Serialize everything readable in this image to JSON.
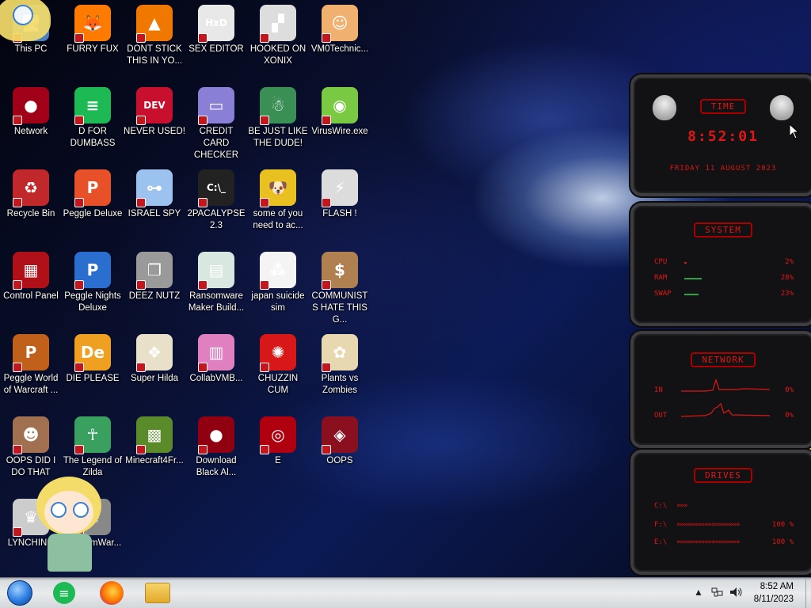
{
  "desktop": {
    "icons": [
      {
        "label": "This PC",
        "glyph": "🖥",
        "color": "#4a7fc1"
      },
      {
        "label": "FURRY FUX",
        "glyph": "🦊",
        "color": "#ff7a00"
      },
      {
        "label": "DONT STICK THIS IN YO...",
        "glyph": "▲",
        "color": "#f07800"
      },
      {
        "label": "SEX EDITOR",
        "glyph": "HxD",
        "color": "#e8e8e8"
      },
      {
        "label": "HOOKED ON XONIX",
        "glyph": "▞",
        "color": "#dddddd"
      },
      {
        "label": "VM0Technic...",
        "glyph": "☺",
        "color": "#f0b070"
      },
      {
        "label": "Network",
        "glyph": "●",
        "color": "#a00018"
      },
      {
        "label": "D FOR DUMBASS",
        "glyph": "≡",
        "color": "#1db954"
      },
      {
        "label": "NEVER USED!",
        "glyph": "DEV",
        "color": "#c8102e"
      },
      {
        "label": "CREDIT CARD CHECKER",
        "glyph": "▭",
        "color": "#8a7fd6"
      },
      {
        "label": "BE JUST LIKE THE DUDE!",
        "glyph": "☃",
        "color": "#3a8f54"
      },
      {
        "label": "VirusWire.exe",
        "glyph": "◉",
        "color": "#7ac943"
      },
      {
        "label": "Recycle Bin",
        "glyph": "♻",
        "color": "#c0282c"
      },
      {
        "label": "Peggle Deluxe",
        "glyph": "P",
        "color": "#e8502a"
      },
      {
        "label": "ISRAEL SPY",
        "glyph": "⊶",
        "color": "#9cc3f0"
      },
      {
        "label": "2PACALYPSE 2.3",
        "glyph": "C:\\_",
        "color": "#222222"
      },
      {
        "label": "some of you need to ac...",
        "glyph": "🐶",
        "color": "#e8c020"
      },
      {
        "label": "FLASH !",
        "glyph": "⚡",
        "color": "#dcdcdc"
      },
      {
        "label": "Control Panel",
        "glyph": "▦",
        "color": "#b01018"
      },
      {
        "label": "Peggle Nights Deluxe",
        "glyph": "P",
        "color": "#2a6fd0"
      },
      {
        "label": "DEEZ NUTZ",
        "glyph": "❐",
        "color": "#9a9a9a"
      },
      {
        "label": "Ransomware Maker Build...",
        "glyph": "▤",
        "color": "#d8e8e0"
      },
      {
        "label": "japan suicide sim",
        "glyph": "⁂",
        "color": "#f4f4f4"
      },
      {
        "label": "COMMUNISTS HATE THIS G...",
        "glyph": "$",
        "color": "#b08050"
      },
      {
        "label": "Peggle World of Warcraft ...",
        "glyph": "P",
        "color": "#c0601a"
      },
      {
        "label": "DIE PLEASE",
        "glyph": "De",
        "color": "#f0a020"
      },
      {
        "label": "Super Hilda",
        "glyph": "❖",
        "color": "#e8e0c8"
      },
      {
        "label": "CollabVMB...",
        "glyph": "▥",
        "color": "#e080c0"
      },
      {
        "label": "CHUZZIN CUM",
        "glyph": "✺",
        "color": "#d81818"
      },
      {
        "label": "Plants vs Zombies",
        "glyph": "✿",
        "color": "#e8d8b0"
      },
      {
        "label": "OOPS DID I DO THAT",
        "glyph": "☻",
        "color": "#a07050"
      },
      {
        "label": "The Legend of Zilda",
        "glyph": "☥",
        "color": "#3aa060"
      },
      {
        "label": "Minecraft4Fr...",
        "glyph": "▩",
        "color": "#5a8a2a"
      },
      {
        "label": "Download Black Al...",
        "glyph": "●",
        "color": "#900010"
      },
      {
        "label": "E",
        "glyph": "◎",
        "color": "#b00010"
      },
      {
        "label": "OOPS",
        "glyph": "◈",
        "color": "#8a1020"
      },
      {
        "label": "LYNCHING",
        "glyph": "♛",
        "color": "#cccccc"
      },
      {
        "label": "RansomWar...",
        "glyph": "☠",
        "color": "#888888"
      }
    ]
  },
  "widgets": {
    "time": {
      "title": "TIME",
      "time": "8:52:01",
      "date": "FRIDAY 11 AUGUST 2023"
    },
    "system": {
      "title": "SYSTEM",
      "rows": [
        {
          "label": "CPU",
          "value": "2%",
          "level": 0.02
        },
        {
          "label": "RAM",
          "value": "28%",
          "level": 0.28
        },
        {
          "label": "SWAP",
          "value": "23%",
          "level": 0.23
        }
      ]
    },
    "network": {
      "title": "NETWORK",
      "rows": [
        {
          "label": "IN",
          "value": "0%"
        },
        {
          "label": "OUT",
          "value": "0%"
        }
      ]
    },
    "drives": {
      "title": "DRIVES",
      "rows": [
        {
          "label": "C:\\",
          "value": "",
          "level": 0.15
        },
        {
          "label": "F:\\",
          "value": "100 %",
          "level": 1.0
        },
        {
          "label": "E:\\",
          "value": "100 %",
          "level": 1.0
        }
      ]
    }
  },
  "taskbar": {
    "start_icon": "start-orb-icon",
    "pinned": [
      "notes-app-icon",
      "firefox-icon",
      "file-explorer-icon"
    ],
    "tray_arrow": "▲",
    "time": "8:52 AM",
    "date": "8/11/2023"
  },
  "colors": {
    "widget_red": "#e01616",
    "taskbar": "#e3e5e7"
  }
}
